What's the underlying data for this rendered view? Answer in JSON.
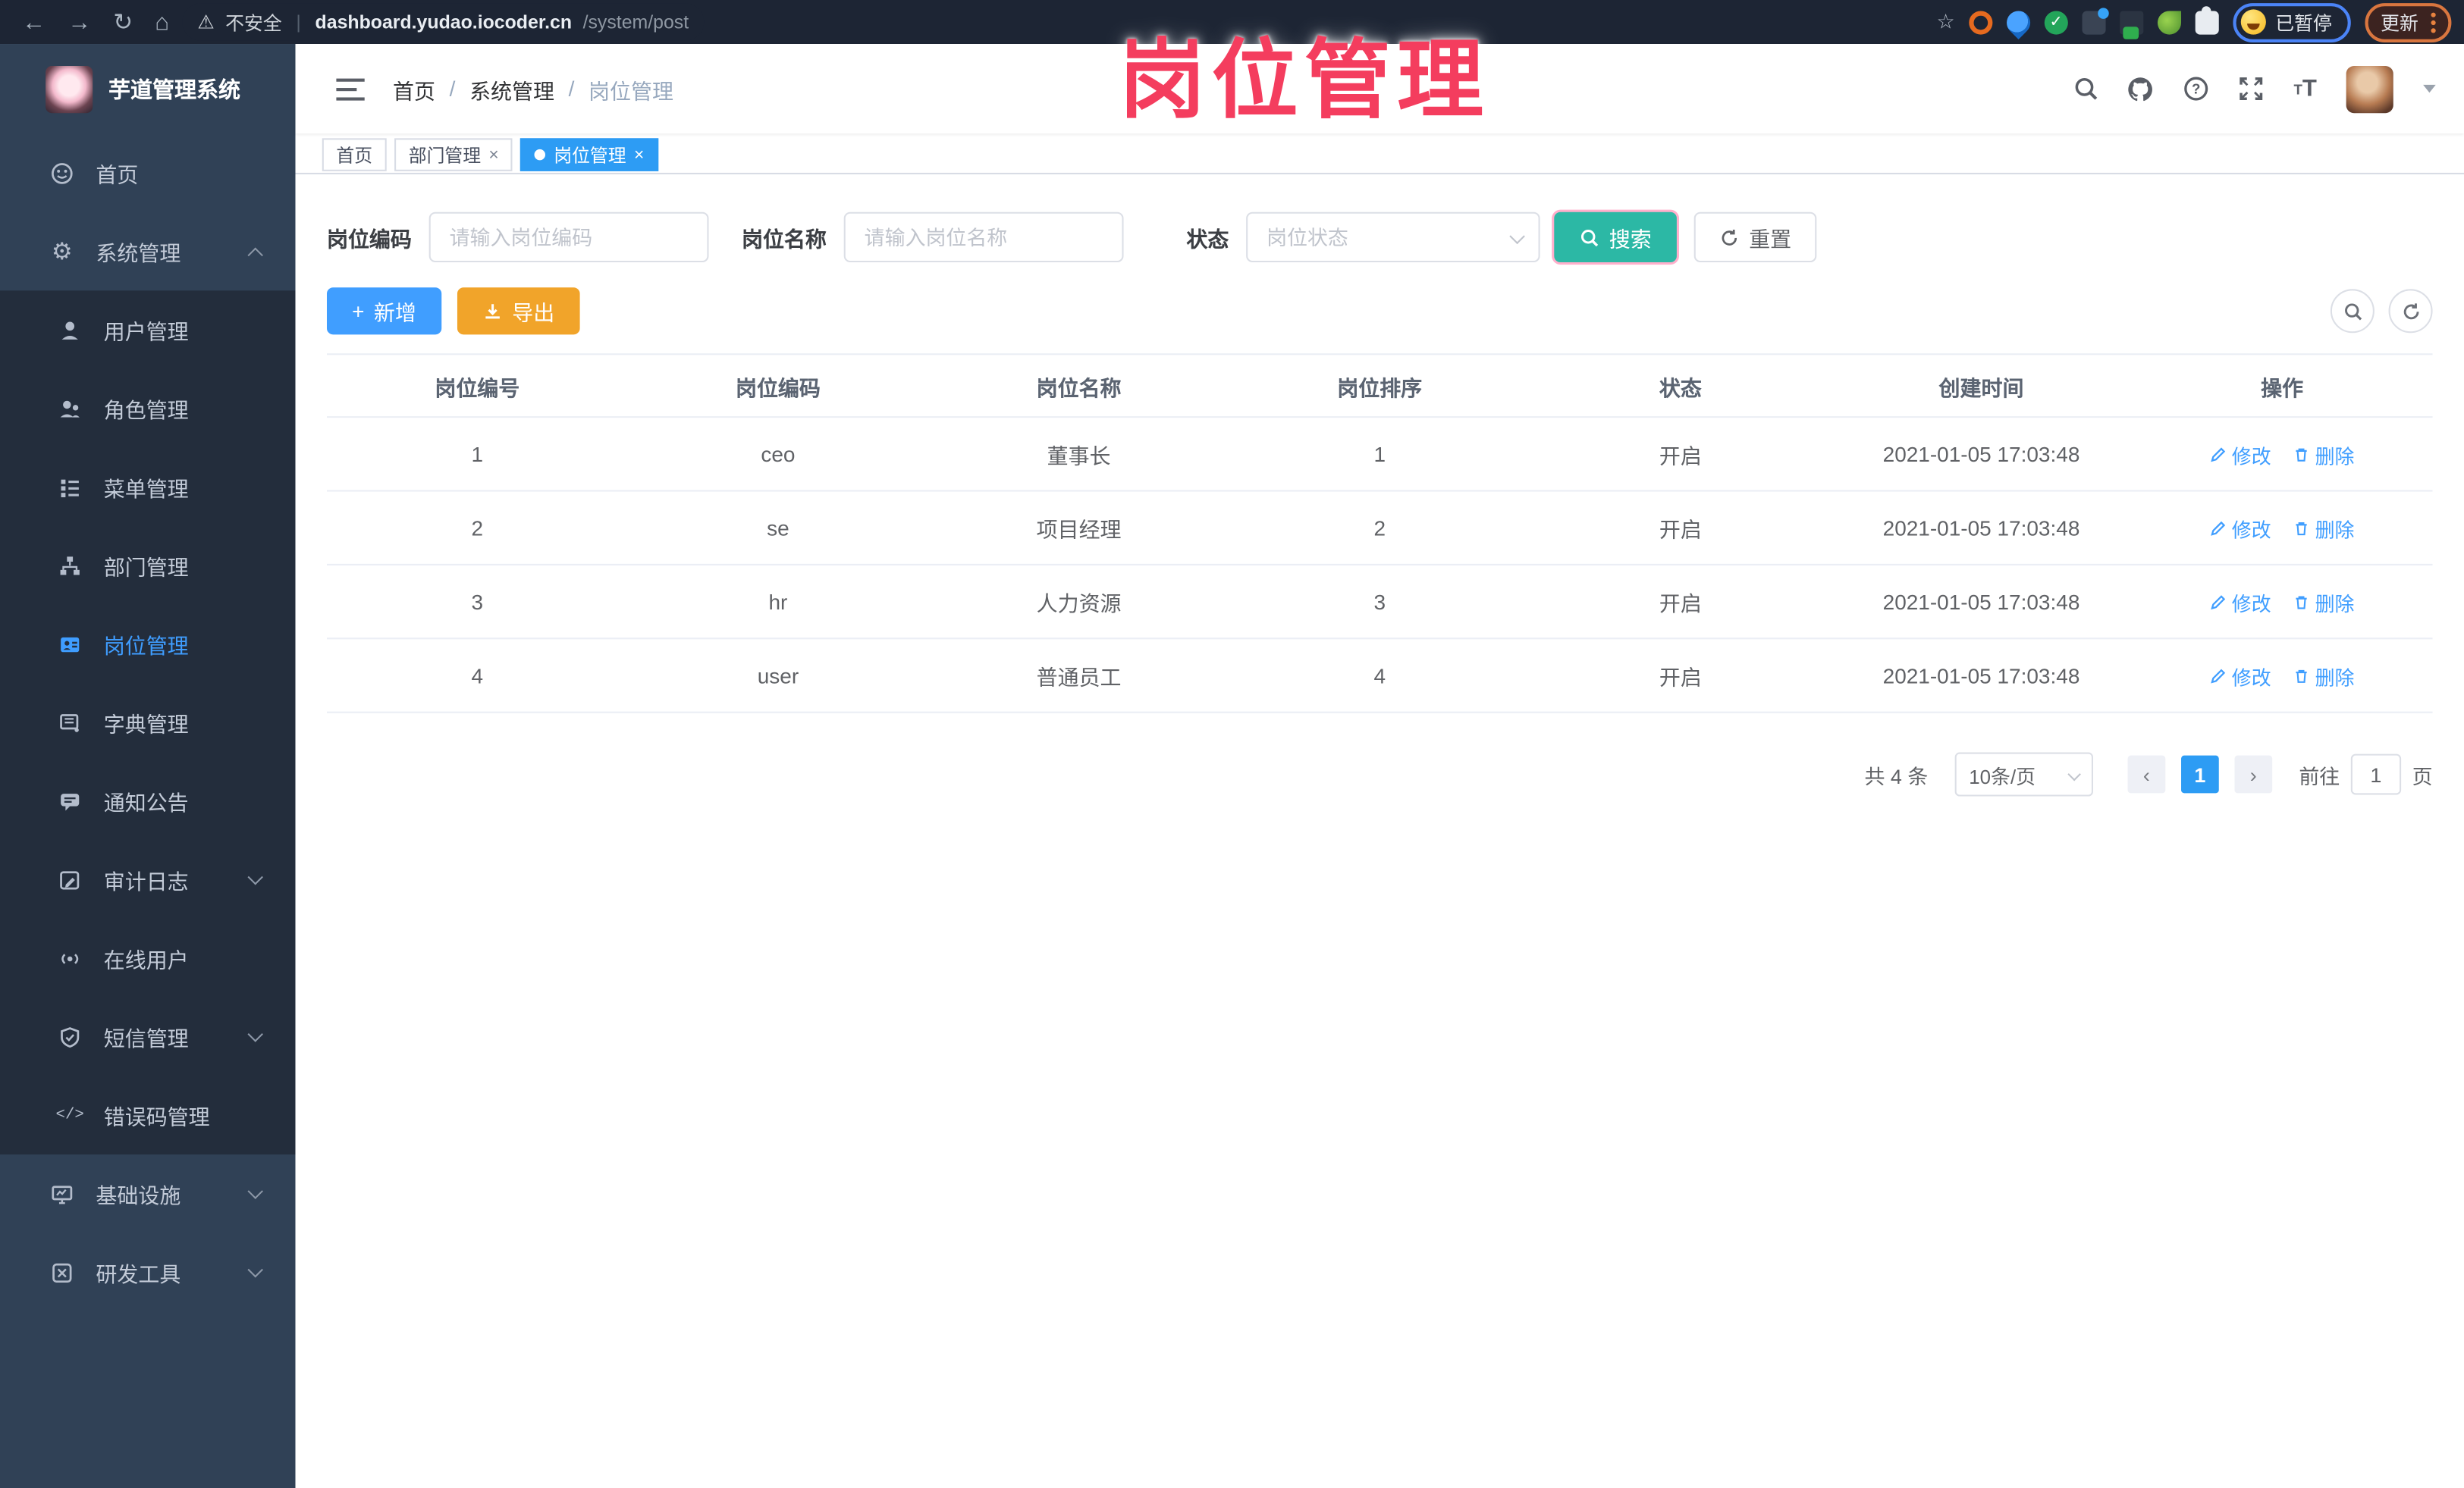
{
  "annotation": {
    "title": "岗位管理"
  },
  "browser": {
    "nav": {
      "back": "←",
      "forward": "→",
      "reload": "↻",
      "home": "⌂"
    },
    "warning_glyph": "⚠",
    "security_label": "不安全",
    "url_host": "dashboard.yudao.iocoder.cn",
    "url_path": "/system/post",
    "bookmark_glyph": "☆",
    "profile_chip": {
      "label": "已暂停"
    },
    "update_label": "更新"
  },
  "sidebar": {
    "app_title": "芋道管理系统",
    "items": [
      {
        "label": "首页"
      },
      {
        "label": "系统管理",
        "state": "expanded"
      },
      {
        "label": "用户管理"
      },
      {
        "label": "角色管理"
      },
      {
        "label": "菜单管理"
      },
      {
        "label": "部门管理"
      },
      {
        "label": "岗位管理",
        "active": true
      },
      {
        "label": "字典管理"
      },
      {
        "label": "通知公告"
      },
      {
        "label": "审计日志",
        "state": "collapsed"
      },
      {
        "label": "在线用户"
      },
      {
        "label": "短信管理",
        "state": "collapsed"
      },
      {
        "label": "错误码管理"
      },
      {
        "label": "基础设施",
        "state": "collapsed"
      },
      {
        "label": "研发工具",
        "state": "collapsed"
      }
    ],
    "gear_glyph": "⚙",
    "code_glyph": "</>"
  },
  "breadcrumb": {
    "items": [
      "首页",
      "系统管理",
      "岗位管理"
    ],
    "separator": "/"
  },
  "tabs": [
    {
      "label": "首页",
      "closable": false,
      "active": false
    },
    {
      "label": "部门管理",
      "closable": true,
      "active": false
    },
    {
      "label": "岗位管理",
      "closable": true,
      "active": true
    }
  ],
  "close_glyph": "×",
  "filters": {
    "code_label": "岗位编码",
    "code_placeholder": "请输入岗位编码",
    "name_label": "岗位名称",
    "name_placeholder": "请输入岗位名称",
    "status_label": "状态",
    "status_placeholder": "岗位状态",
    "search_label": "搜索",
    "reset_label": "重置"
  },
  "toolbar": {
    "add_label": "新增",
    "export_label": "导出",
    "plus_glyph": "+"
  },
  "table": {
    "headers": [
      "岗位编号",
      "岗位编码",
      "岗位名称",
      "岗位排序",
      "状态",
      "创建时间",
      "操作"
    ],
    "edit_label": "修改",
    "delete_label": "删除",
    "rows": [
      {
        "id": "1",
        "code": "ceo",
        "name": "董事长",
        "sort": "1",
        "status": "开启",
        "created": "2021-01-05 17:03:48"
      },
      {
        "id": "2",
        "code": "se",
        "name": "项目经理",
        "sort": "2",
        "status": "开启",
        "created": "2021-01-05 17:03:48"
      },
      {
        "id": "3",
        "code": "hr",
        "name": "人力资源",
        "sort": "3",
        "status": "开启",
        "created": "2021-01-05 17:03:48"
      },
      {
        "id": "4",
        "code": "user",
        "name": "普通员工",
        "sort": "4",
        "status": "开启",
        "created": "2021-01-05 17:03:48"
      }
    ]
  },
  "pagination": {
    "total_text": "共 4 条",
    "page_size": "10条/页",
    "prev_glyph": "‹",
    "next_glyph": "›",
    "current_page": "1",
    "goto_prefix": "前往",
    "goto_value": "1",
    "goto_suffix": "页"
  },
  "colors": {
    "accent": "#409eff",
    "search_teal": "#2cb8a5",
    "export_orange": "#f1a42a",
    "annotation_pink": "#f43d5e",
    "sidebar_bg": "#304156",
    "submenu_bg": "#232d3c"
  }
}
